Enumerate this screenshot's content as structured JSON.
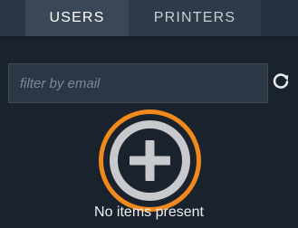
{
  "tabs": {
    "users_label": "USERS",
    "printers_label": "PRINTERS",
    "active": "USERS"
  },
  "filter": {
    "placeholder": "filter by email",
    "value": ""
  },
  "icons": {
    "refresh": "refresh-icon",
    "add": "add-circle-icon"
  },
  "empty_state": {
    "message": "No items present"
  },
  "colors": {
    "background": "#1a222d",
    "tab_active": "#3a4757",
    "tab_inactive": "#2f3a48",
    "input_background": "#2c3746",
    "accent_ring": "#f08a1c",
    "icon_gray": "#c7c9cc"
  }
}
